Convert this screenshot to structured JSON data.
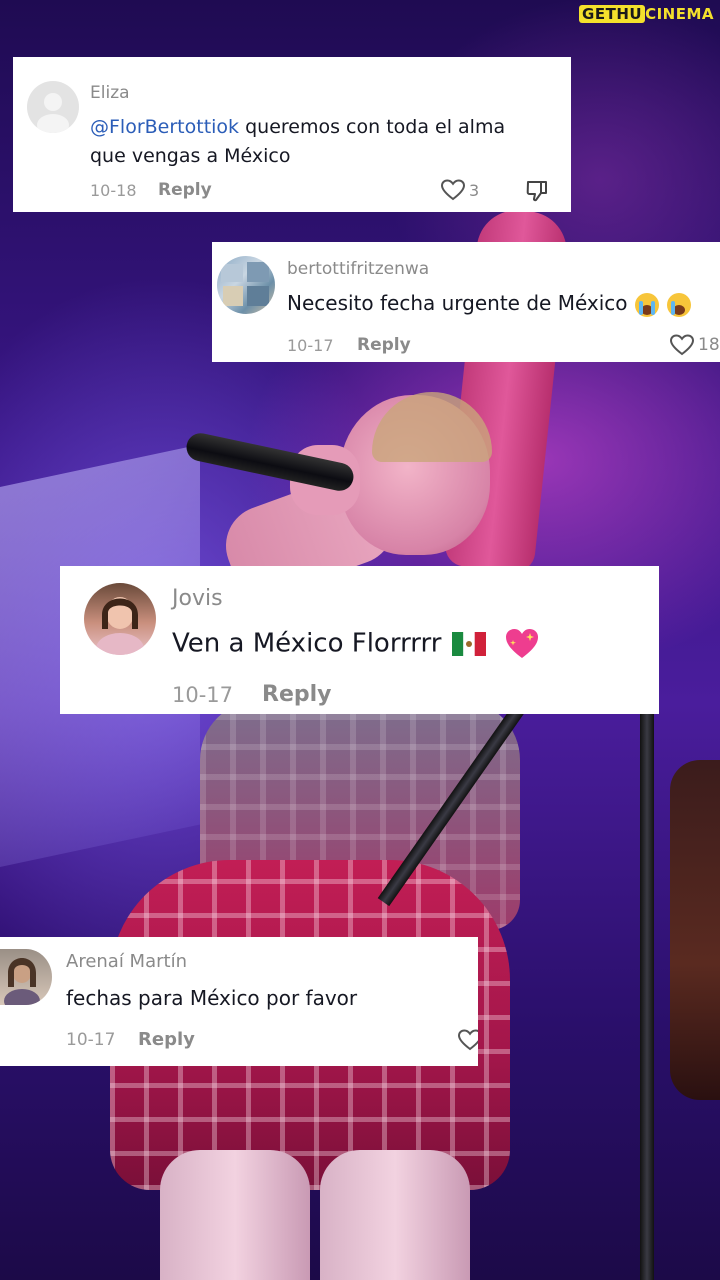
{
  "watermark": {
    "prefix": "GETHU",
    "suffix": "CINEMA"
  },
  "comments": [
    {
      "author": "Eliza",
      "mention": "@FlorBertottiok",
      "text_line1": " queremos con toda el alma",
      "text_line2": "que vengas a México",
      "date": "10-18",
      "reply_label": "Reply",
      "likes": "3",
      "avatar_icon": "default-avatar-icon"
    },
    {
      "author": "bertottifritzenwa",
      "text": "Necesito fecha urgente de México",
      "emoji": "loudly-crying-face",
      "date": "10-17",
      "reply_label": "Reply",
      "likes": "18",
      "avatar_icon": "photo-collage-avatar"
    },
    {
      "author": "Jovis",
      "text": "Ven a México Florrrrr",
      "emoji": [
        "mexico-flag",
        "sparkling-heart"
      ],
      "date": "10-17",
      "reply_label": "Reply",
      "avatar_icon": "selfie-avatar"
    },
    {
      "author": "Arenaí  Martín",
      "text": "fechas para México por favor",
      "date": "10-17",
      "reply_label": "Reply",
      "avatar_icon": "portrait-avatar"
    }
  ],
  "colors": {
    "mention": "#2b5db8",
    "card_bg": "#ffffff",
    "meta_text": "#8a8a8a",
    "watermark": "#f4e02c"
  }
}
